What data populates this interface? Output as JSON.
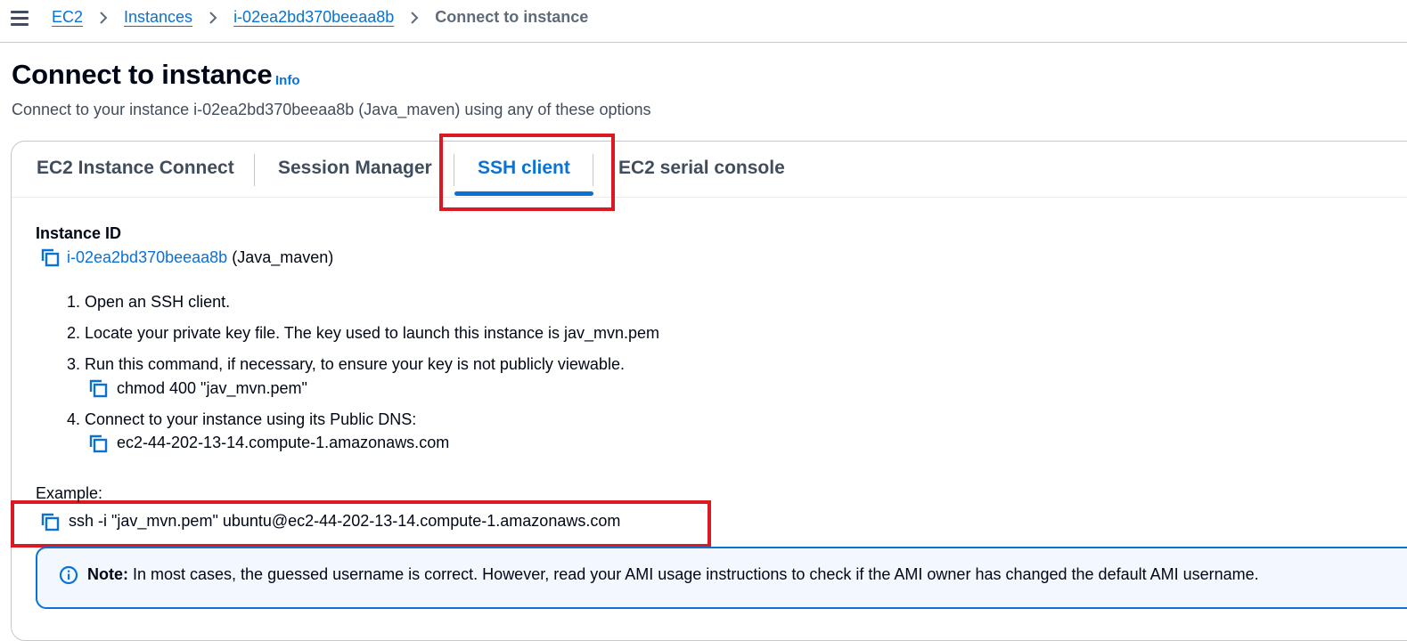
{
  "breadcrumb": {
    "items": [
      "EC2",
      "Instances",
      "i-02ea2bd370beeaa8b"
    ],
    "current": "Connect to instance"
  },
  "page": {
    "title": "Connect to instance",
    "info_label": "Info",
    "subtitle": "Connect to your instance i-02ea2bd370beeaa8b (Java_maven) using any of these options"
  },
  "tabs": [
    {
      "label": "EC2 Instance Connect"
    },
    {
      "label": "Session Manager"
    },
    {
      "label": "SSH client"
    },
    {
      "label": "EC2 serial console"
    }
  ],
  "active_tab": "SSH client",
  "ssh": {
    "instance_id_label": "Instance ID",
    "instance_id": "i-02ea2bd370beeaa8b",
    "instance_name": "(Java_maven)",
    "steps": [
      "1. Open an SSH client.",
      "2. Locate your private key file. The key used to launch this instance is jav_mvn.pem",
      "3. Run this command, if necessary, to ensure your key is not publicly viewable.",
      "4. Connect to your instance using its Public DNS:"
    ],
    "chmod_command": "chmod 400 \"jav_mvn.pem\"",
    "public_dns": "ec2-44-202-13-14.compute-1.amazonaws.com",
    "example_label": "Example:",
    "example_command": "ssh -i \"jav_mvn.pem\" ubuntu@ec2-44-202-13-14.compute-1.amazonaws.com"
  },
  "note": {
    "prefix": "Note:",
    "text": " In most cases, the guessed username is correct. However, read your AMI usage instructions to check if the AMI owner has changed the default AMI username."
  },
  "icons": [
    "menu-icon",
    "chevron-right-icon",
    "copy-icon",
    "info-icon"
  ],
  "colors": {
    "link": "#0972d3",
    "highlight": "#d91a22",
    "note_background": "#f2f8fd",
    "text": "#000716"
  }
}
